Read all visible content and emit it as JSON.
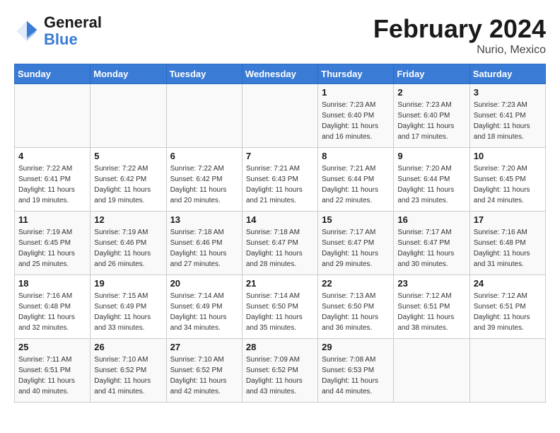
{
  "logo": {
    "text_general": "General",
    "text_blue": "Blue"
  },
  "header": {
    "title": "February 2024",
    "subtitle": "Nurio, Mexico"
  },
  "weekdays": [
    "Sunday",
    "Monday",
    "Tuesday",
    "Wednesday",
    "Thursday",
    "Friday",
    "Saturday"
  ],
  "weeks": [
    [
      {
        "day": "",
        "info": ""
      },
      {
        "day": "",
        "info": ""
      },
      {
        "day": "",
        "info": ""
      },
      {
        "day": "",
        "info": ""
      },
      {
        "day": "1",
        "info": "Sunrise: 7:23 AM\nSunset: 6:40 PM\nDaylight: 11 hours and 16 minutes."
      },
      {
        "day": "2",
        "info": "Sunrise: 7:23 AM\nSunset: 6:40 PM\nDaylight: 11 hours and 17 minutes."
      },
      {
        "day": "3",
        "info": "Sunrise: 7:23 AM\nSunset: 6:41 PM\nDaylight: 11 hours and 18 minutes."
      }
    ],
    [
      {
        "day": "4",
        "info": "Sunrise: 7:22 AM\nSunset: 6:41 PM\nDaylight: 11 hours and 19 minutes."
      },
      {
        "day": "5",
        "info": "Sunrise: 7:22 AM\nSunset: 6:42 PM\nDaylight: 11 hours and 19 minutes."
      },
      {
        "day": "6",
        "info": "Sunrise: 7:22 AM\nSunset: 6:42 PM\nDaylight: 11 hours and 20 minutes."
      },
      {
        "day": "7",
        "info": "Sunrise: 7:21 AM\nSunset: 6:43 PM\nDaylight: 11 hours and 21 minutes."
      },
      {
        "day": "8",
        "info": "Sunrise: 7:21 AM\nSunset: 6:44 PM\nDaylight: 11 hours and 22 minutes."
      },
      {
        "day": "9",
        "info": "Sunrise: 7:20 AM\nSunset: 6:44 PM\nDaylight: 11 hours and 23 minutes."
      },
      {
        "day": "10",
        "info": "Sunrise: 7:20 AM\nSunset: 6:45 PM\nDaylight: 11 hours and 24 minutes."
      }
    ],
    [
      {
        "day": "11",
        "info": "Sunrise: 7:19 AM\nSunset: 6:45 PM\nDaylight: 11 hours and 25 minutes."
      },
      {
        "day": "12",
        "info": "Sunrise: 7:19 AM\nSunset: 6:46 PM\nDaylight: 11 hours and 26 minutes."
      },
      {
        "day": "13",
        "info": "Sunrise: 7:18 AM\nSunset: 6:46 PM\nDaylight: 11 hours and 27 minutes."
      },
      {
        "day": "14",
        "info": "Sunrise: 7:18 AM\nSunset: 6:47 PM\nDaylight: 11 hours and 28 minutes."
      },
      {
        "day": "15",
        "info": "Sunrise: 7:17 AM\nSunset: 6:47 PM\nDaylight: 11 hours and 29 minutes."
      },
      {
        "day": "16",
        "info": "Sunrise: 7:17 AM\nSunset: 6:47 PM\nDaylight: 11 hours and 30 minutes."
      },
      {
        "day": "17",
        "info": "Sunrise: 7:16 AM\nSunset: 6:48 PM\nDaylight: 11 hours and 31 minutes."
      }
    ],
    [
      {
        "day": "18",
        "info": "Sunrise: 7:16 AM\nSunset: 6:48 PM\nDaylight: 11 hours and 32 minutes."
      },
      {
        "day": "19",
        "info": "Sunrise: 7:15 AM\nSunset: 6:49 PM\nDaylight: 11 hours and 33 minutes."
      },
      {
        "day": "20",
        "info": "Sunrise: 7:14 AM\nSunset: 6:49 PM\nDaylight: 11 hours and 34 minutes."
      },
      {
        "day": "21",
        "info": "Sunrise: 7:14 AM\nSunset: 6:50 PM\nDaylight: 11 hours and 35 minutes."
      },
      {
        "day": "22",
        "info": "Sunrise: 7:13 AM\nSunset: 6:50 PM\nDaylight: 11 hours and 36 minutes."
      },
      {
        "day": "23",
        "info": "Sunrise: 7:12 AM\nSunset: 6:51 PM\nDaylight: 11 hours and 38 minutes."
      },
      {
        "day": "24",
        "info": "Sunrise: 7:12 AM\nSunset: 6:51 PM\nDaylight: 11 hours and 39 minutes."
      }
    ],
    [
      {
        "day": "25",
        "info": "Sunrise: 7:11 AM\nSunset: 6:51 PM\nDaylight: 11 hours and 40 minutes."
      },
      {
        "day": "26",
        "info": "Sunrise: 7:10 AM\nSunset: 6:52 PM\nDaylight: 11 hours and 41 minutes."
      },
      {
        "day": "27",
        "info": "Sunrise: 7:10 AM\nSunset: 6:52 PM\nDaylight: 11 hours and 42 minutes."
      },
      {
        "day": "28",
        "info": "Sunrise: 7:09 AM\nSunset: 6:52 PM\nDaylight: 11 hours and 43 minutes."
      },
      {
        "day": "29",
        "info": "Sunrise: 7:08 AM\nSunset: 6:53 PM\nDaylight: 11 hours and 44 minutes."
      },
      {
        "day": "",
        "info": ""
      },
      {
        "day": "",
        "info": ""
      }
    ]
  ]
}
